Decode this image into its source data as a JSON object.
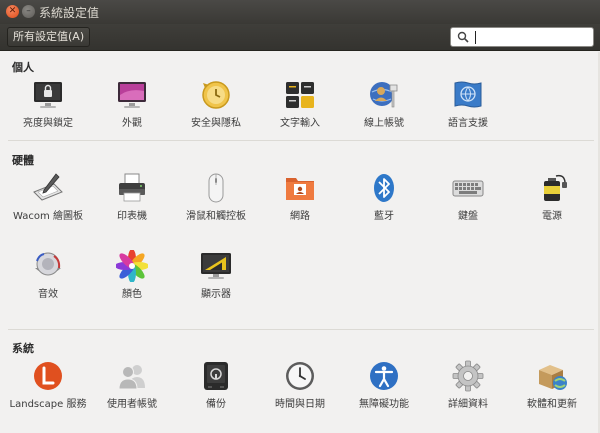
{
  "window": {
    "title": "系統設定值"
  },
  "toolbar": {
    "all_settings_label": "所有設定值(A)",
    "search_value": "",
    "search_placeholder": ""
  },
  "sections": {
    "personal": {
      "title": "個人",
      "items": [
        {
          "label": "亮度與鎖定",
          "icon": "brightness-lock-icon"
        },
        {
          "label": "外觀",
          "icon": "appearance-icon"
        },
        {
          "label": "安全與隱私",
          "icon": "security-privacy-icon"
        },
        {
          "label": "文字輸入",
          "icon": "text-entry-icon"
        },
        {
          "label": "線上帳號",
          "icon": "online-accounts-icon"
        },
        {
          "label": "語言支援",
          "icon": "language-support-icon"
        }
      ]
    },
    "hardware": {
      "title": "硬體",
      "items": [
        {
          "label": "Wacom 繪圖板",
          "icon": "wacom-tablet-icon"
        },
        {
          "label": "印表機",
          "icon": "printer-icon"
        },
        {
          "label": "滑鼠和觸控板",
          "icon": "mouse-icon"
        },
        {
          "label": "網路",
          "icon": "network-icon"
        },
        {
          "label": "藍牙",
          "icon": "bluetooth-icon"
        },
        {
          "label": "鍵盤",
          "icon": "keyboard-icon"
        },
        {
          "label": "電源",
          "icon": "power-icon"
        },
        {
          "label": "音效",
          "icon": "sound-icon"
        },
        {
          "label": "顏色",
          "icon": "color-icon"
        },
        {
          "label": "顯示器",
          "icon": "displays-icon"
        }
      ]
    },
    "system": {
      "title": "系統",
      "items": [
        {
          "label": "Landscape 服務",
          "icon": "landscape-icon"
        },
        {
          "label": "使用者帳號",
          "icon": "user-accounts-icon"
        },
        {
          "label": "備份",
          "icon": "backup-icon"
        },
        {
          "label": "時間與日期",
          "icon": "clock-icon"
        },
        {
          "label": "無障礙功能",
          "icon": "accessibility-icon"
        },
        {
          "label": "詳細資料",
          "icon": "details-gear-icon"
        },
        {
          "label": "軟體和更新",
          "icon": "software-updates-icon"
        }
      ]
    }
  }
}
